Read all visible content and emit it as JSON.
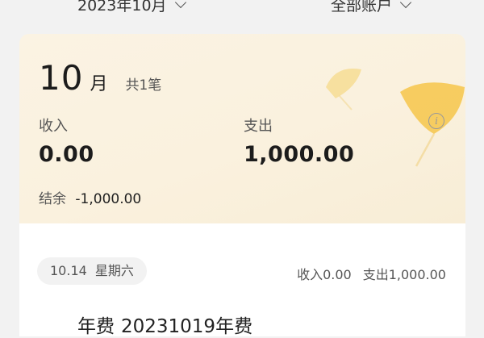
{
  "header": {
    "month_filter": "2023年10月",
    "account_filter": "全部账户"
  },
  "summary": {
    "month_number": "10",
    "month_unit": "月",
    "record_count": "共1笔",
    "income_label": "收入",
    "income_value": "0.00",
    "expense_label": "支出",
    "expense_value": "1,000.00",
    "balance_label": "结余",
    "balance_value": "-1,000.00",
    "info_icon": "info-icon"
  },
  "list": {
    "day": {
      "date": "10.14",
      "weekday": "星期六",
      "income_text": "收入0.00",
      "expense_text": "支出1,000.00"
    },
    "entries": [
      {
        "title": "年费",
        "note": "20231019年费"
      }
    ]
  },
  "colors": {
    "card_bg": "#faf1de",
    "accent_leaf": "#f6c64a",
    "page_bg": "#f2f2f2"
  }
}
